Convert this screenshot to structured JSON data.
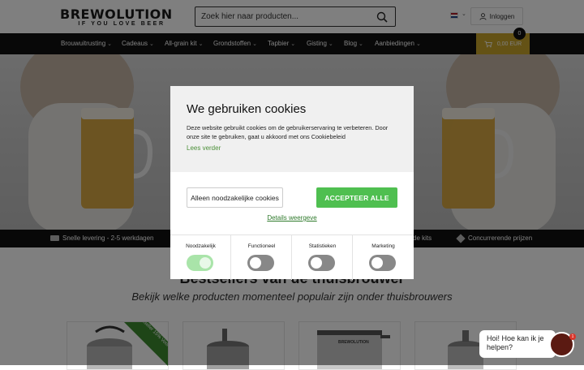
{
  "header": {
    "logo_main": "BREWOLUTION",
    "logo_tagline": "IF YOU LOVE BEER",
    "search_placeholder": "Zoek hier naar producten...",
    "search_icon": "search-icon",
    "language_flag": "netherlands-flag",
    "login_label": "Inloggen",
    "login_icon": "user-icon"
  },
  "nav": {
    "items": [
      {
        "label": "Brouwuitrusting"
      },
      {
        "label": "Cadeaus"
      },
      {
        "label": "All-grain kit"
      },
      {
        "label": "Grondstoffen"
      },
      {
        "label": "Tapbier"
      },
      {
        "label": "Gisting"
      },
      {
        "label": "Blog"
      },
      {
        "label": "Aanbiedingen"
      }
    ],
    "cart_amount": "0,00 EUR",
    "cart_count": "0",
    "cart_icon": "cart-icon"
  },
  "usp": {
    "items": [
      {
        "label": "Snelle levering - 2-5 werkdagen",
        "icon": "truck-icon"
      },
      {
        "label": "de kits"
      },
      {
        "label": "Concurrerende prijzen",
        "icon": "tag-icon"
      }
    ]
  },
  "bestsellers": {
    "title": "Bestsellers van de thuisbrouwer",
    "subtitle": "Bekijk welke producten momenteel populair zijn onder thuisbrouwers",
    "ribbon": "Bestseller 15% Voordeelpakket",
    "kettle_brand": "BREWOLUTION"
  },
  "cookie_modal": {
    "title": "We gebruiken cookies",
    "text": "Deze website gebruikt cookies om de gebruikerservaring te verbeteren. Door onze site te gebruiken, gaat u akkoord met ons Cookiebeleid",
    "read_more": "Lees verder",
    "necessary_button": "Alleen noodzakelijke cookies",
    "accept_button": "ACCEPTEER ALLE",
    "details_link": "Details weergeve",
    "toggles": [
      {
        "label": "Noodzakelijk",
        "on": true
      },
      {
        "label": "Functioneel",
        "on": false
      },
      {
        "label": "Statistieken",
        "on": false
      },
      {
        "label": "Marketing",
        "on": false
      }
    ],
    "accent_color": "#4fbf50"
  },
  "chat": {
    "message": "Hoi! Hoe kan ik je helpen?",
    "unread": "1"
  }
}
